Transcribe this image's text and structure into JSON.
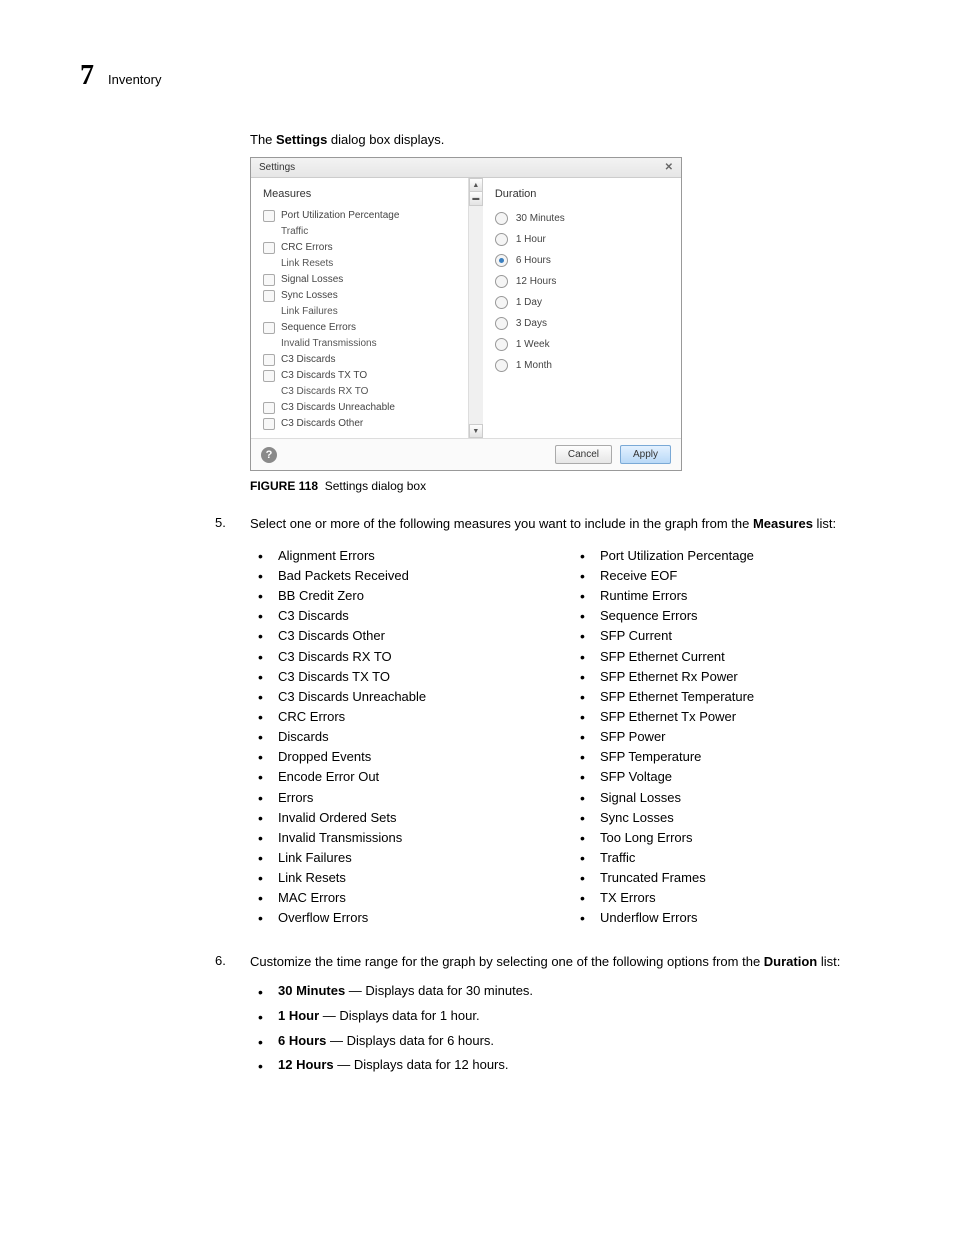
{
  "header": {
    "chapter_num": "7",
    "section": "Inventory"
  },
  "intro": {
    "pre": "The ",
    "bold": "Settings",
    "post": " dialog box displays."
  },
  "dialog": {
    "title": "Settings",
    "close": "✕",
    "measures_head": "Measures",
    "measures": [
      {
        "label": "Port Utilization Percentage",
        "box": true
      },
      {
        "label": "Traffic",
        "box": false
      },
      {
        "label": "CRC Errors",
        "box": true
      },
      {
        "label": "Link Resets",
        "box": false
      },
      {
        "label": "Signal Losses",
        "box": true
      },
      {
        "label": "Sync Losses",
        "box": true
      },
      {
        "label": "Link Failures",
        "box": false
      },
      {
        "label": "Sequence Errors",
        "box": true
      },
      {
        "label": "Invalid Transmissions",
        "box": false
      },
      {
        "label": "C3 Discards",
        "box": true
      },
      {
        "label": "C3 Discards TX TO",
        "box": true
      },
      {
        "label": "C3 Discards RX TO",
        "box": false
      },
      {
        "label": "C3 Discards Unreachable",
        "box": true
      },
      {
        "label": "C3 Discards Other",
        "box": true
      }
    ],
    "duration_head": "Duration",
    "durations": [
      {
        "label": "30 Minutes",
        "selected": false
      },
      {
        "label": "1 Hour",
        "selected": false
      },
      {
        "label": "6 Hours",
        "selected": true
      },
      {
        "label": "12 Hours",
        "selected": false
      },
      {
        "label": "1 Day",
        "selected": false
      },
      {
        "label": "3 Days",
        "selected": false
      },
      {
        "label": "1 Week",
        "selected": false
      },
      {
        "label": "1 Month",
        "selected": false
      }
    ],
    "help": "?",
    "cancel": "Cancel",
    "apply": "Apply"
  },
  "figure": {
    "label": "FIGURE 118",
    "caption": "Settings dialog box"
  },
  "step5": {
    "num": "5.",
    "text_pre": "Select one or more of the following measures you want to include in the graph from the ",
    "bold": "Measures",
    "text_post": " list:",
    "left": [
      "Alignment Errors",
      "Bad Packets Received",
      "BB Credit Zero",
      "C3 Discards",
      "C3 Discards Other",
      "C3 Discards RX TO",
      "C3 Discards TX TO",
      "C3 Discards Unreachable",
      "CRC Errors",
      "Discards",
      "Dropped Events",
      "Encode Error Out",
      "Errors",
      "Invalid Ordered Sets",
      "Invalid Transmissions",
      "Link Failures",
      "Link Resets",
      "MAC Errors",
      "Overflow Errors"
    ],
    "right": [
      "Port Utilization Percentage",
      "Receive EOF",
      "Runtime Errors",
      "Sequence Errors",
      "SFP Current",
      "SFP Ethernet Current",
      "SFP Ethernet Rx Power",
      "SFP Ethernet Temperature",
      "SFP Ethernet Tx Power",
      "SFP Power",
      "SFP Temperature",
      "SFP Voltage",
      "Signal Losses",
      "Sync Losses",
      "Too Long Errors",
      "Traffic",
      "Truncated Frames",
      "TX Errors",
      "Underflow Errors"
    ]
  },
  "step6": {
    "num": "6.",
    "text_pre": "Customize the time range for the graph by selecting one of the following options from the ",
    "bold": "Duration",
    "text_post": " list:",
    "items": [
      {
        "b": "30 Minutes",
        "d": " — Displays data for 30 minutes."
      },
      {
        "b": "1 Hour",
        "d": " — Displays data for 1 hour."
      },
      {
        "b": "6 Hours",
        "d": " — Displays data for 6 hours."
      },
      {
        "b": "12 Hours",
        "d": " — Displays data for 12 hours."
      }
    ]
  }
}
